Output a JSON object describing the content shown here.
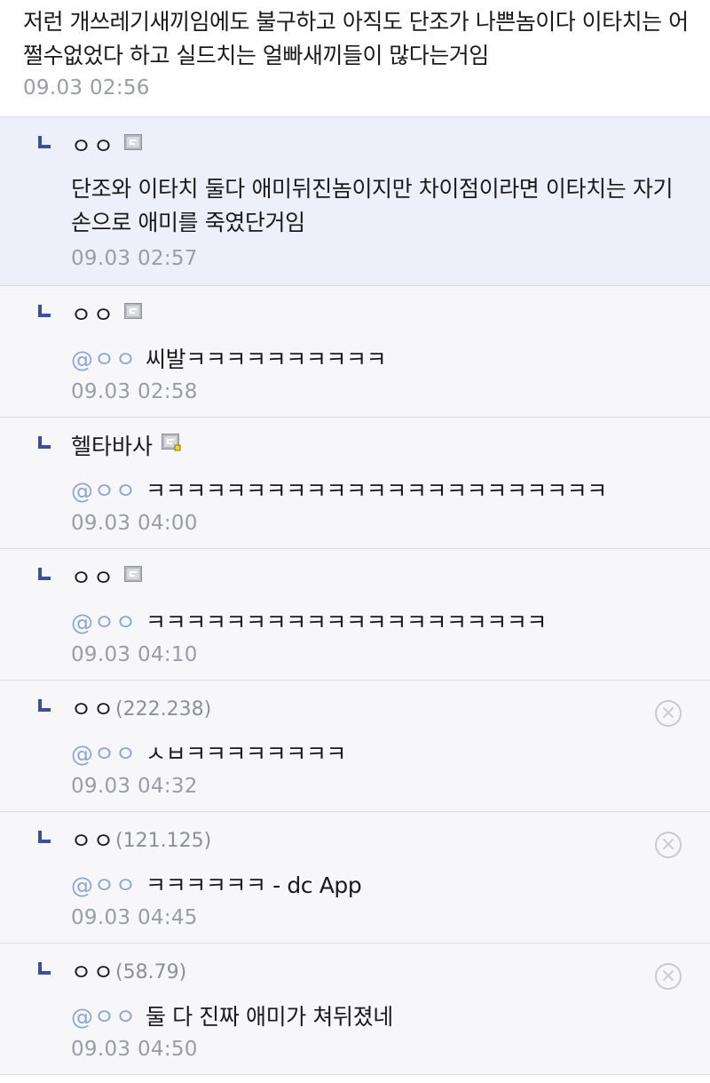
{
  "parent_comment": {
    "text": "저런 개쓰레기새끼임에도 불구하고 아직도 단조가 나쁜놈이다 이타치는 어쩔수없었다 하고 실드치는 얼빠새끼들이 많다는거임",
    "time": "09.03 02:56"
  },
  "replies": [
    {
      "nick": "ㅇㅇ",
      "ip": "",
      "badge": "fixed-nick-gallog-icon",
      "deletable": false,
      "mention": "",
      "text": "단조와 이타치 둘다 애미뒤진놈이지만 차이점이라면 이타치는 자기손으로 애미를 죽였단거임",
      "time": "09.03 02:57"
    },
    {
      "nick": "ㅇㅇ",
      "ip": "",
      "badge": "fixed-nick-gallog-icon",
      "deletable": false,
      "mention": "@ㅇㅇ",
      "text": "씨발ㅋㅋㅋㅋㅋㅋㅋㅋㅋㅋ",
      "time": "09.03 02:58"
    },
    {
      "nick": "헬타바사",
      "ip": "",
      "badge": "semi-fixed-nick-gallog-icon",
      "deletable": false,
      "mention": "@ㅇㅇ",
      "text": "ㅋㅋㅋㅋㅋㅋㅋㅋㅋㅋㅋㅋㅋㅋㅋㅋㅋㅋㅋㅋㅋㅋㅋ",
      "time": "09.03 04:00"
    },
    {
      "nick": "ㅇㅇ",
      "ip": "",
      "badge": "fixed-nick-gallog-icon",
      "deletable": false,
      "mention": "@ㅇㅇ",
      "text": "ㅋㅋㅋㅋㅋㅋㅋㅋㅋㅋㅋㅋㅋㅋㅋㅋㅋㅋㅋㅋ",
      "time": "09.03 04:10"
    },
    {
      "nick": "ㅇㅇ",
      "ip": "(222.238)",
      "badge": "",
      "deletable": true,
      "mention": "@ㅇㅇ",
      "text": "ㅅㅂㅋㅋㅋㅋㅋㅋㅋㅋ",
      "time": "09.03 04:32"
    },
    {
      "nick": "ㅇㅇ",
      "ip": "(121.125)",
      "badge": "",
      "deletable": true,
      "mention": "@ㅇㅇ",
      "text": "ㅋㅋㅋㅋㅋㅋ - dc App",
      "time": "09.03 04:45"
    },
    {
      "nick": "ㅇㅇ",
      "ip": "(58.79)",
      "badge": "",
      "deletable": true,
      "mention": "@ㅇㅇ",
      "text": "둘 다 진짜 애미가 쳐뒤졌네",
      "time": "09.03 04:50"
    }
  ],
  "colors": {
    "highlight_bg": "#edf0fb",
    "reply_bg": "#f7f7f9",
    "arrow": "#3f4da0",
    "mention": "#8fa4d9",
    "time": "#9a9ca6"
  }
}
